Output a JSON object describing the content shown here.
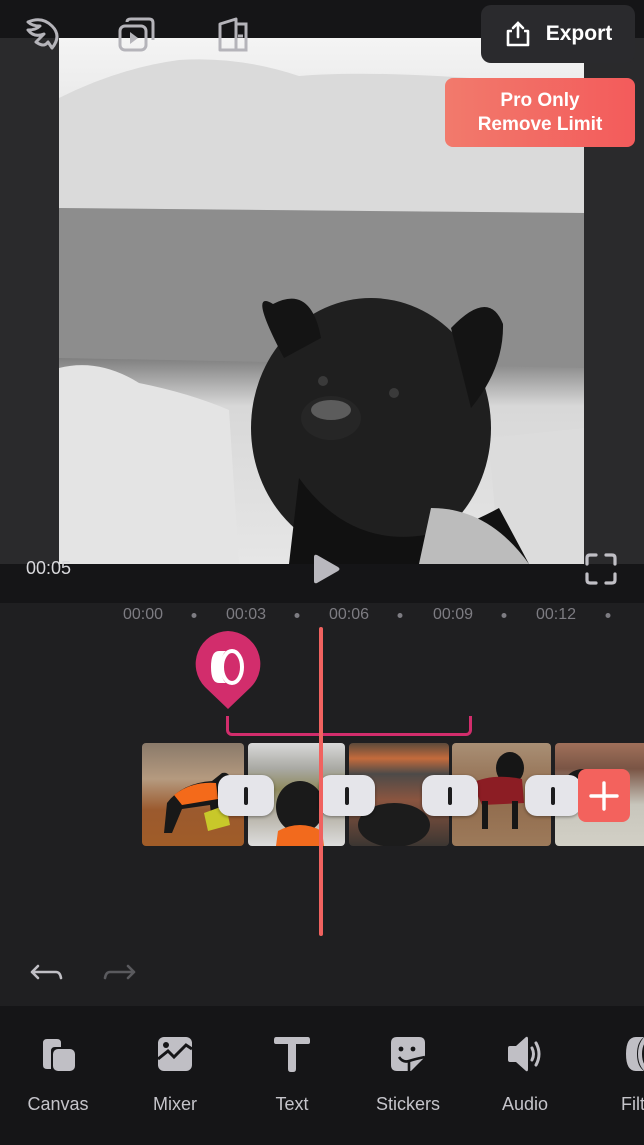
{
  "header": {
    "icons": [
      {
        "name": "templates-icon"
      },
      {
        "name": "slideshow-icon"
      },
      {
        "name": "projects-icon"
      }
    ],
    "export_label": "Export",
    "pro_line1": "Pro Only",
    "pro_line2": "Remove Limit"
  },
  "player": {
    "current_time": "00:05",
    "play_icon": "play-icon",
    "fullscreen_icon": "fullscreen-icon"
  },
  "timeline": {
    "ticks": [
      "00:00",
      "00:03",
      "00:06",
      "00:09",
      "00:12"
    ],
    "effect_icon": "filter-effect-icon",
    "clips": [
      {
        "description": "dog in orange vest in forest"
      },
      {
        "description": "dog at mountain overlook"
      },
      {
        "description": "dog by fireplace"
      },
      {
        "description": "dog in plaid coat"
      },
      {
        "description": "dog on bed"
      }
    ],
    "transitions": 4,
    "add_label": "+"
  },
  "history": {
    "undo": "undo-icon",
    "redo": "redo-icon"
  },
  "toolbar": {
    "items": [
      {
        "label": "Canvas",
        "icon": "canvas-icon"
      },
      {
        "label": "Mixer",
        "icon": "mixer-icon"
      },
      {
        "label": "Text",
        "icon": "text-icon"
      },
      {
        "label": "Stickers",
        "icon": "stickers-icon"
      },
      {
        "label": "Audio",
        "icon": "audio-icon"
      },
      {
        "label": "Filter",
        "icon": "filter-icon"
      }
    ]
  },
  "colors": {
    "accent": "#f3625d",
    "effect": "#d22d6c",
    "background": "#1f1f21",
    "toolbar": "#151517"
  }
}
